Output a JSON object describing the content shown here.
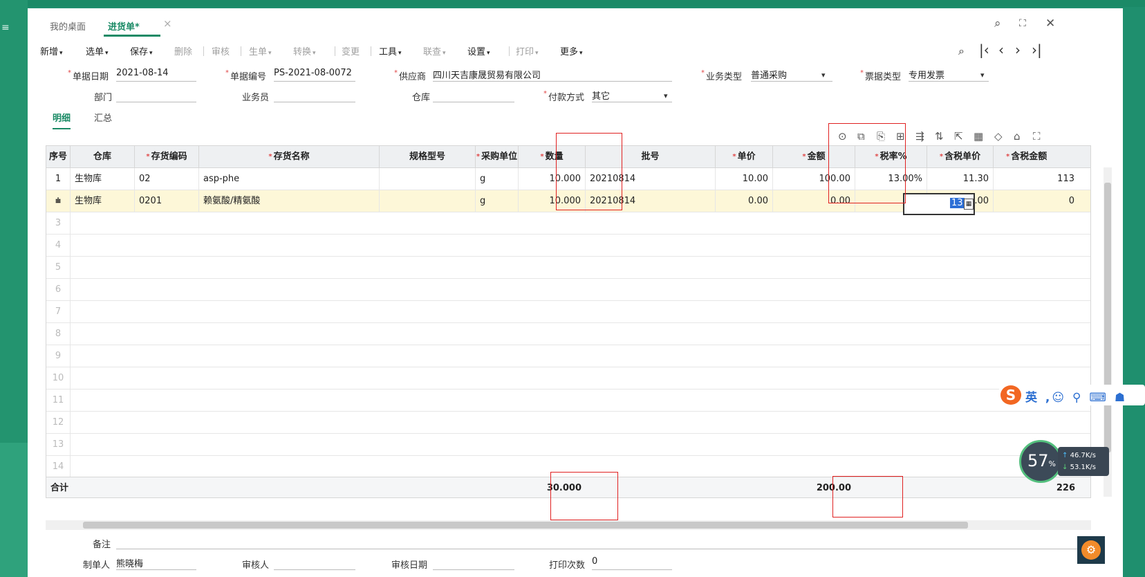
{
  "tabs": [
    {
      "label": "我的桌面"
    },
    {
      "label": "进货单*"
    }
  ],
  "toolbar": {
    "items": [
      "新增",
      "选单",
      "保存",
      "删除",
      "审核",
      "生单",
      "转换",
      "变更",
      "工具",
      "联查",
      "设置",
      "打印",
      "更多"
    ]
  },
  "form": {
    "date_label": "单据日期",
    "date_value": "2021-08-14",
    "code_label": "单据编号",
    "code_value": "PS-2021-08-0072",
    "supplier_label": "供应商",
    "supplier_value": "四川天吉康晟贸易有限公司",
    "biz_label": "业务类型",
    "biz_value": "普通采购",
    "invoice_label": "票据类型",
    "invoice_value": "专用发票",
    "dept_label": "部门",
    "staff_label": "业务员",
    "wh_label": "仓库",
    "pay_label": "付款方式",
    "pay_value": "其它"
  },
  "subtabs": [
    "明细",
    "汇总"
  ],
  "grid": {
    "headers": [
      "序号",
      "仓库",
      "存货编码",
      "存货名称",
      "规格型号",
      "采购单位",
      "数量",
      "批号",
      "单价",
      "金额",
      "税率%",
      "含税单价",
      "含税金额"
    ],
    "rows": [
      {
        "no": "1",
        "wh": "生物库",
        "code": "02",
        "name": "asp-phe",
        "spec": "",
        "unit": "g",
        "qty": "10.000",
        "batch": "20210814",
        "price": "10.00",
        "amount": "100.00",
        "tax": "13.00%",
        "tprice": "11.30",
        "tamount": "113"
      },
      {
        "no": "2",
        "wh": "生物库",
        "code": "0201",
        "name": "赖氨酸/精氨酸",
        "spec": "",
        "unit": "g",
        "qty": "10.000",
        "batch": "20210814",
        "price": "0.00",
        "amount": "0.00",
        "tax": "13",
        "tprice": "0.00",
        "tamount": "0"
      }
    ],
    "empty_rows": [
      "3",
      "4",
      "5",
      "6",
      "7",
      "8",
      "9",
      "10",
      "11",
      "12",
      "13",
      "14"
    ],
    "total_label": "合计",
    "total_qty": "30.000",
    "total_amount": "200.00",
    "total_tamount": "226"
  },
  "bottom": {
    "remark_label": "备注",
    "maker_label": "制单人",
    "maker_value": "熊晓梅",
    "auditor_label": "审核人",
    "audit_date_label": "审核日期",
    "print_label": "打印次数",
    "print_value": "0"
  },
  "ime": {
    "mode": "英"
  },
  "speed": {
    "pct": "57",
    "pct_unit": "%",
    "up": "46.7K/s",
    "down": "53.1K/s"
  },
  "colors": {
    "brand": "#1a8a65",
    "highlight_row": "#fdf7d8",
    "annotation": "#e02020"
  }
}
